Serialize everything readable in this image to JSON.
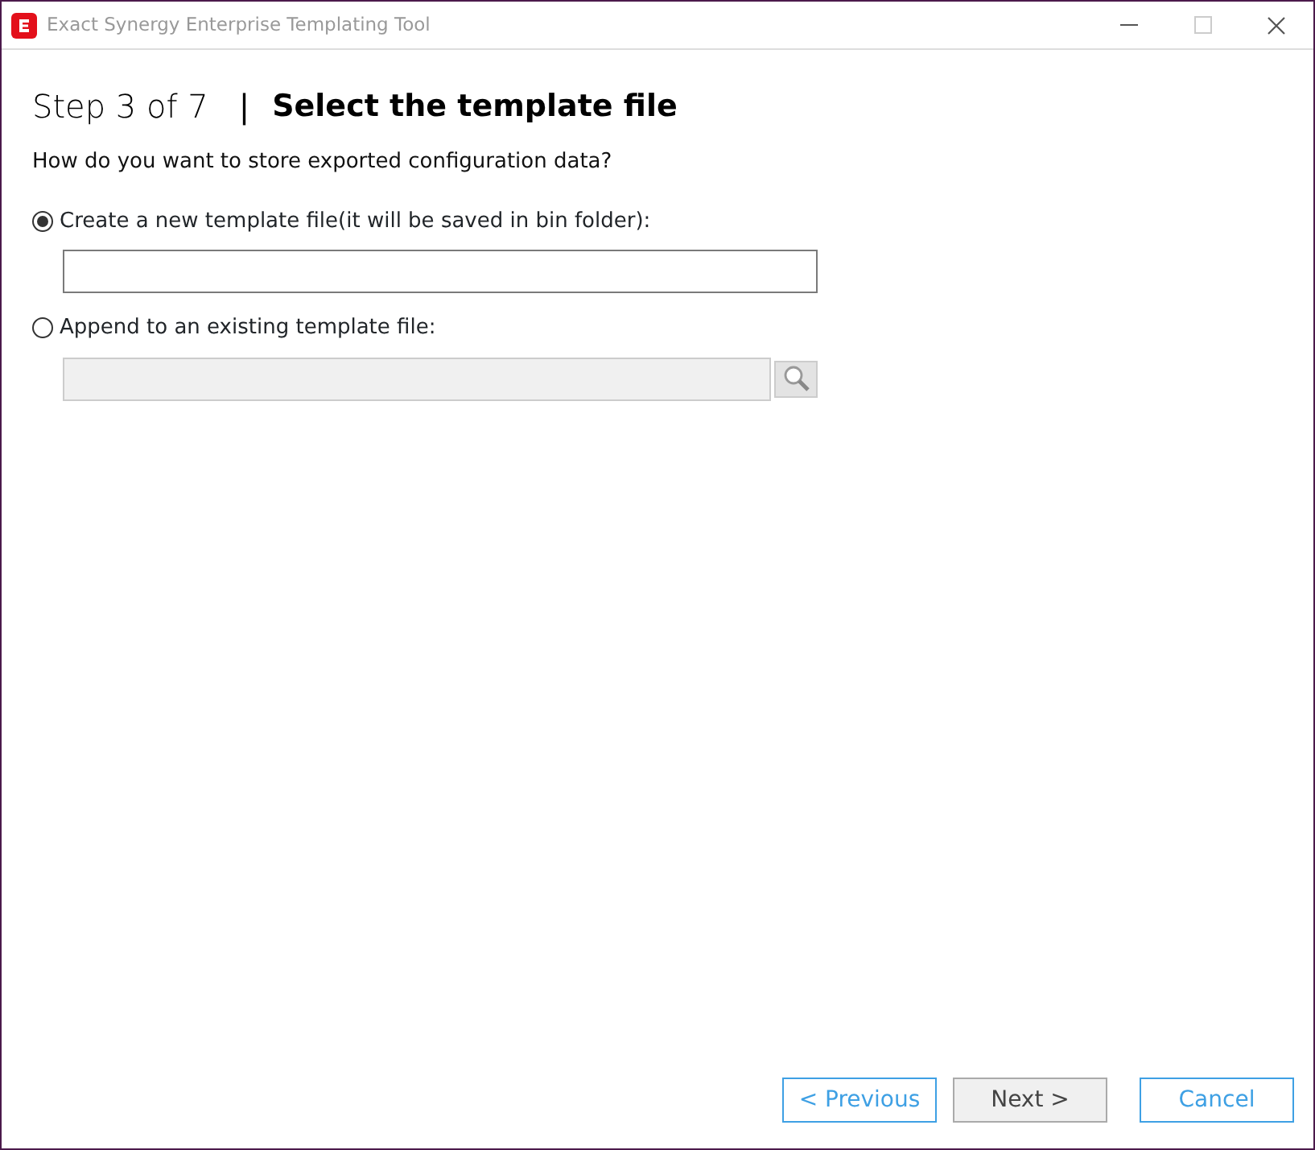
{
  "window": {
    "title": "Exact Synergy Enterprise Templating Tool",
    "maximize_disabled": true
  },
  "step": {
    "counter": "Step 3 of 7",
    "separator": "|",
    "title": "Select the template file"
  },
  "question": "How do you want to store exported configuration data?",
  "options": [
    {
      "label": "Create a new template file(it will be saved in bin folder):",
      "selected": true,
      "field_disabled": false,
      "browse": false
    },
    {
      "label": "Append to an existing template file:",
      "selected": false,
      "field_disabled": true,
      "browse": true
    }
  ],
  "buttons": [
    {
      "label": "< Previous",
      "kind": "outline"
    },
    {
      "label": "Next >",
      "kind": "default"
    },
    {
      "label": "Cancel",
      "kind": "outline"
    }
  ]
}
